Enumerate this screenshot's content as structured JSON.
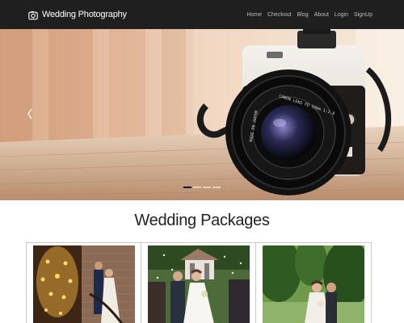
{
  "navbar": {
    "brand": "Wedding Photography",
    "brand_icon": "camera-icon",
    "links": [
      "Home",
      "Checkout",
      "Blog",
      "About",
      "Login",
      "SignUp"
    ]
  },
  "hero": {
    "prev_icon": "chevron-left-icon",
    "indicator_count": 4,
    "active_indicator": 1,
    "lens_text_top": "CANON LENS FD 50mm 1:1.8",
    "lens_text_side": "MADE IN JAPAN"
  },
  "packages": {
    "title": "Wedding Packages",
    "items": [
      {
        "photo": "couple-chandelier-photo"
      },
      {
        "photo": "couple-gazebo-photo"
      },
      {
        "photo": "couple-garden-photo"
      }
    ]
  },
  "colors": {
    "navbar_bg": "#1f1f1f",
    "nav_link": "#bdbdbd",
    "active_indicator": "#111111"
  }
}
